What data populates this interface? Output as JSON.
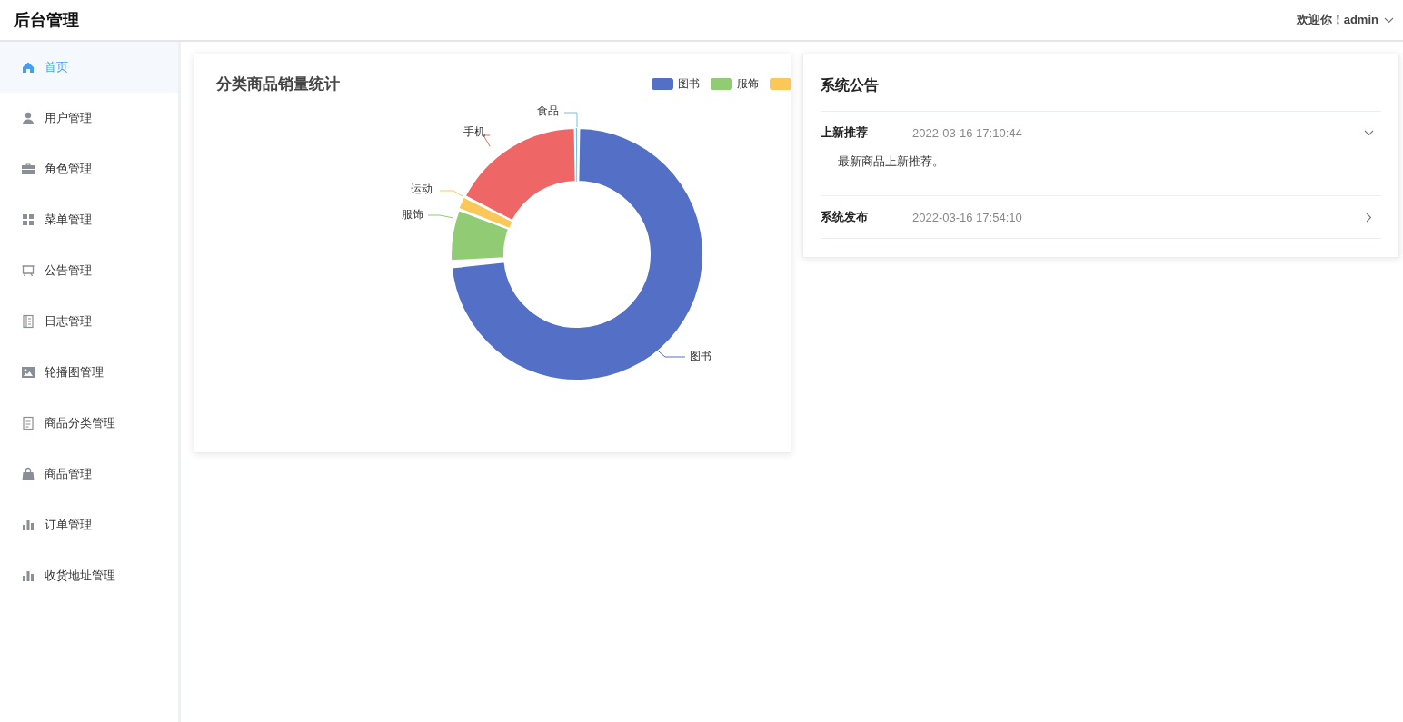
{
  "header": {
    "title": "后台管理",
    "greeting": "欢迎你！admin"
  },
  "sidebar": {
    "items": [
      {
        "label": "首页",
        "selected": true
      },
      {
        "label": "用户管理",
        "selected": false
      },
      {
        "label": "角色管理",
        "selected": false
      },
      {
        "label": "菜单管理",
        "selected": false
      },
      {
        "label": "公告管理",
        "selected": false
      },
      {
        "label": "日志管理",
        "selected": false
      },
      {
        "label": "轮播图管理",
        "selected": false
      },
      {
        "label": "商品分类管理",
        "selected": false
      },
      {
        "label": "商品管理",
        "selected": false
      },
      {
        "label": "订单管理",
        "selected": false
      },
      {
        "label": "收货地址管理",
        "selected": false
      }
    ]
  },
  "sales_card": {
    "title": "分类商品销量统计",
    "legend": [
      {
        "label": "图书",
        "color": "#5470c6"
      },
      {
        "label": "服饰",
        "color": "#91cc75"
      },
      {
        "color": "#fac858"
      }
    ],
    "slices": [
      {
        "label": "图书",
        "color": "#5470c6"
      },
      {
        "label": "服饰",
        "color": "#91cc75"
      },
      {
        "label": "运动",
        "color": "#fac858"
      },
      {
        "label": "手机",
        "color": "#ee6666"
      },
      {
        "label": "食品",
        "color": "#73c0de"
      }
    ]
  },
  "notice_card": {
    "title": "系统公告",
    "items": [
      {
        "title": "上新推荐",
        "time": "2022-03-16 17:10:44",
        "expanded": true,
        "body": "最新商品上新推荐。"
      },
      {
        "title": "系统发布",
        "time": "2022-03-16 17:54:10",
        "expanded": false
      }
    ]
  }
}
